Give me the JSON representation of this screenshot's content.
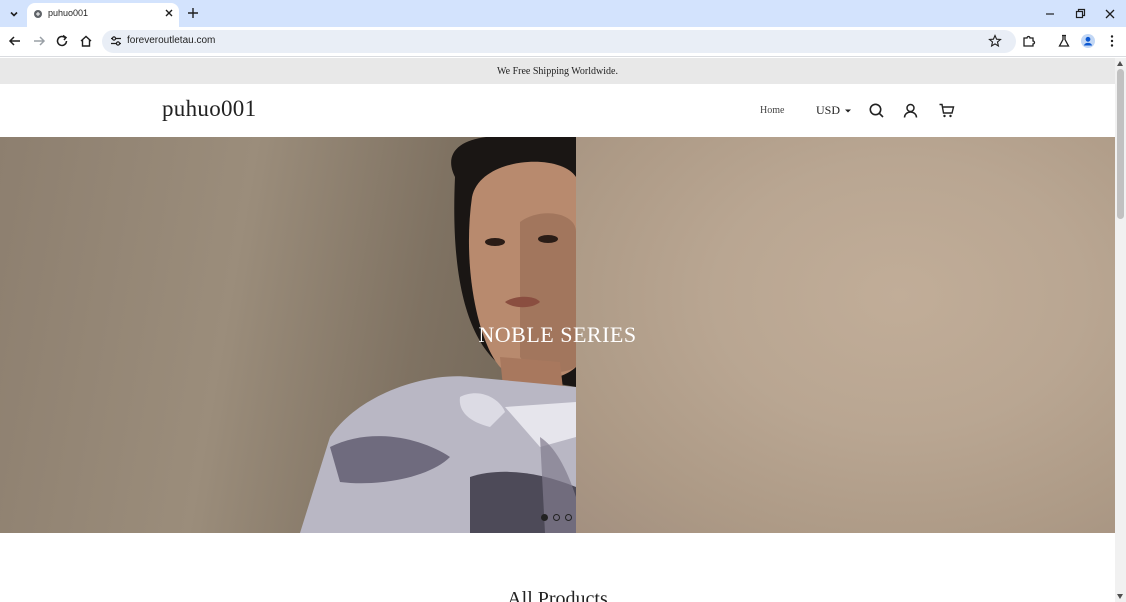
{
  "browser": {
    "tab": {
      "title": "puhuo001"
    },
    "address_bar": {
      "url": "foreveroutletau.com"
    },
    "icons": {
      "tab_list": "chevron-down-icon",
      "new_tab": "plus-icon",
      "back": "arrow-left-icon",
      "forward": "arrow-right-icon",
      "reload": "reload-icon",
      "home": "home-icon",
      "site_info": "tune-icon",
      "bookmark": "star-icon",
      "extensions": "puzzle-icon",
      "labs": "flask-icon",
      "profile": "profile-icon",
      "menu": "kebab-menu-icon"
    }
  },
  "announcement": {
    "text": "We Free Shipping Worldwide."
  },
  "header": {
    "logo": "puhuo001",
    "nav": {
      "home": "Home"
    },
    "currency": "USD",
    "icons": [
      "search-icon",
      "account-icon",
      "cart-icon"
    ]
  },
  "hero": {
    "title": "NOBLE SERIES",
    "slide_count": 3,
    "active_slide": 1
  },
  "section": {
    "title": "All Products"
  },
  "colors": {
    "tabbar_bg": "#d3e3fd",
    "announcement_bg": "#e8e8e8",
    "text_dark": "#222222",
    "hero_right": "#b9a692"
  }
}
